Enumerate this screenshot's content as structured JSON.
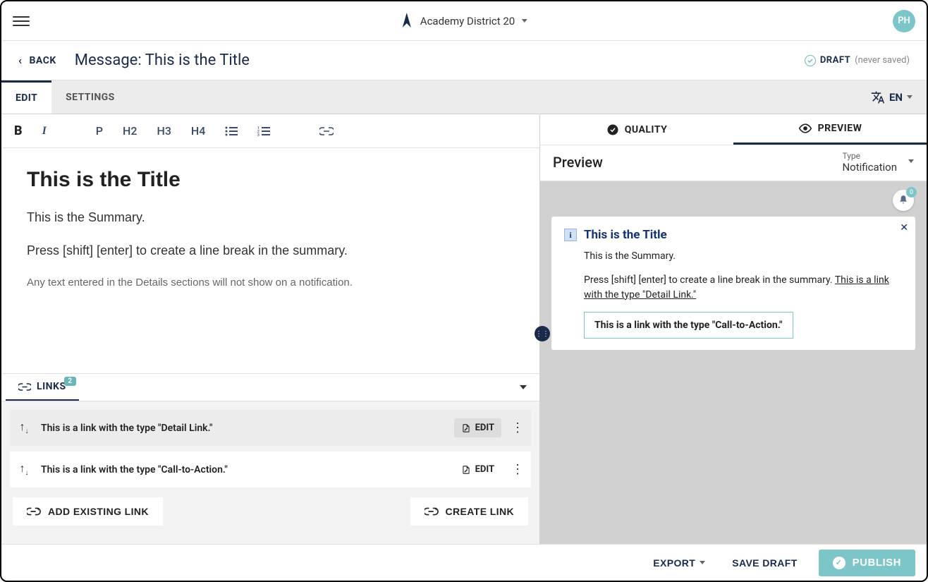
{
  "topbar": {
    "org_name": "Academy District 20",
    "avatar_initials": "PH"
  },
  "subheader": {
    "back_label": "BACK",
    "page_title": "Message: This is the Title",
    "draft_label": "DRAFT",
    "draft_saved": "(never saved)"
  },
  "tabs": {
    "edit": "EDIT",
    "settings": "SETTINGS",
    "lang_label": "EN"
  },
  "toolbar": {
    "bold": "B",
    "italic": "I",
    "p": "P",
    "h2": "H2",
    "h3": "H3",
    "h4": "H4"
  },
  "editor": {
    "title": "This is the Title",
    "summary": "This is the Summary.",
    "summary2": "Press [shift] [enter] to create a line break in the summary.",
    "hint": "Any text entered in the Details sections will not show on a notification."
  },
  "links": {
    "section_label": "LINKS",
    "count": "2",
    "items": [
      {
        "text": "This is a link with the type \"Detail Link.\"",
        "edit": "EDIT"
      },
      {
        "text": "This is a link with the type \"Call-to-Action.\"",
        "edit": "EDIT"
      }
    ],
    "add_existing": "ADD EXISTING LINK",
    "create": "CREATE LINK"
  },
  "right": {
    "quality_tab": "QUALITY",
    "preview_tab": "PREVIEW",
    "preview_heading": "Preview",
    "type_label": "Type",
    "type_value": "Notification",
    "bell_count": "0"
  },
  "notification": {
    "title": "This is the Title",
    "summary": "This is the Summary.",
    "body_prefix": "Press [shift] [enter] to create a line break in the summary. ",
    "detail_link": "This is a link with the type \"Detail Link.\"",
    "cta": "This is a link with the type \"Call-to-Action.\""
  },
  "footer": {
    "export": "EXPORT",
    "save_draft": "SAVE DRAFT",
    "publish": "PUBLISH"
  }
}
